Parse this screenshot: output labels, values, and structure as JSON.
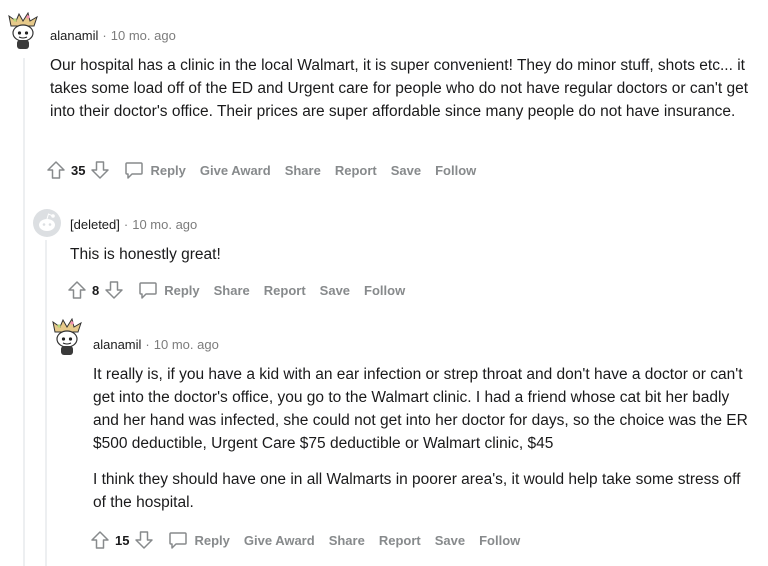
{
  "comments": [
    {
      "author": "alanamil",
      "time": "10 mo. ago",
      "paragraphs": [
        "Our hospital has a clinic in the local Walmart, it is super convenient! They do minor stuff, shots etc... it takes some load off of the ED and Urgent care for people who do not have regular doctors or can't get into their doctor's office. Their prices are super affordable since many people do not have insurance."
      ],
      "score": "35",
      "actions": [
        "Reply",
        "Give Award",
        "Share",
        "Report",
        "Save",
        "Follow"
      ]
    },
    {
      "author": "[deleted]",
      "time": "10 mo. ago",
      "paragraphs": [
        "This is honestly great!"
      ],
      "score": "8",
      "actions": [
        "Reply",
        "Share",
        "Report",
        "Save",
        "Follow"
      ]
    },
    {
      "author": "alanamil",
      "time": "10 mo. ago",
      "paragraphs": [
        "It really is, if you have a kid with an ear infection or strep throat and don't have a doctor or can't get into the doctor's office, you go to the Walmart clinic. I had a friend whose cat bit her badly and her hand was infected, she could not get into her doctor for days, so the choice was the ER $500 deductible, Urgent Care $75 deductible or Walmart clinic, $45",
        "I think they should have one in all Walmarts in poorer area's, it would help take some stress off of the hospital."
      ],
      "score": "15",
      "actions": [
        "Reply",
        "Give Award",
        "Share",
        "Report",
        "Save",
        "Follow"
      ]
    }
  ],
  "separator": "·",
  "icons": {
    "upvote": "upvote-arrow-icon",
    "downvote": "downvote-arrow-icon",
    "reply": "speech-bubble-icon",
    "avatar_user": "snoo-avatar-icon",
    "avatar_deleted": "deleted-user-icon"
  }
}
